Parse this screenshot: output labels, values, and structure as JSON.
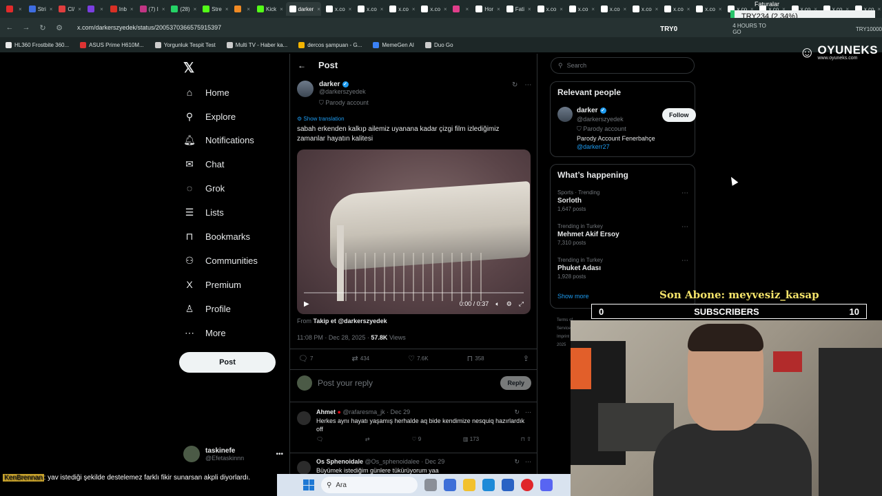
{
  "browser": {
    "tabs": [
      {
        "label": "",
        "color": "#e02b2b"
      },
      {
        "label": "Stri",
        "color": "#3e6de0"
      },
      {
        "label": "Cl/",
        "color": "#e03e3e"
      },
      {
        "label": "",
        "color": "#7a3ee0"
      },
      {
        "label": "Inb",
        "color": "#d93025"
      },
      {
        "label": "(7) I",
        "color": "#c13584"
      },
      {
        "label": "(28)",
        "color": "#25d366"
      },
      {
        "label": "Stre",
        "color": "#53fc18"
      },
      {
        "label": "",
        "color": "#f08a24"
      },
      {
        "label": "Kick",
        "color": "#53fc18"
      },
      {
        "label": "darker",
        "color": "#ffffff",
        "active": true
      },
      {
        "label": "x.co",
        "color": "#ffffff"
      },
      {
        "label": "x.co",
        "color": "#ffffff"
      },
      {
        "label": "x.co",
        "color": "#ffffff"
      },
      {
        "label": "x.co",
        "color": "#ffffff"
      },
      {
        "label": "",
        "color": "#e03e8a"
      },
      {
        "label": "Hor",
        "color": "#ffffff"
      },
      {
        "label": "Fati",
        "color": "#ffffff"
      },
      {
        "label": "x.co",
        "color": "#ffffff"
      },
      {
        "label": "x.co",
        "color": "#ffffff"
      },
      {
        "label": "x.co",
        "color": "#ffffff"
      },
      {
        "label": "x.co",
        "color": "#ffffff"
      },
      {
        "label": "x.co",
        "color": "#ffffff"
      },
      {
        "label": "x.co",
        "color": "#ffffff"
      },
      {
        "label": "x.co",
        "color": "#ffffff"
      },
      {
        "label": "x.co",
        "color": "#ffffff"
      },
      {
        "label": "x.co",
        "color": "#ffffff"
      },
      {
        "label": "x.co",
        "color": "#ffffff"
      },
      {
        "label": "x.co",
        "color": "#ffffff"
      }
    ],
    "url": "x.com/darkerszyedek/status/2005370366575915397",
    "bookmarks": [
      {
        "label": "HL360 Frostbite 360...",
        "color": "#e8e8e8"
      },
      {
        "label": "ASUS Prime H610M...",
        "color": "#d33"
      },
      {
        "label": "Yorgunluk Tespit Test",
        "color": "#ccc"
      },
      {
        "label": "Multi TV - Haber ka...",
        "color": "#ccc"
      },
      {
        "label": "dercos şampuan - G...",
        "color": "#f4b400"
      },
      {
        "label": "MemeGen AI",
        "color": "#3b82f6"
      },
      {
        "label": "Duo Go",
        "color": "#ccc"
      }
    ],
    "right_items": [
      "TRY0",
      "4 HOURS TO GO",
      "TRY10000"
    ]
  },
  "overlay": {
    "faturalar": "Faturalar",
    "ticker": "TRY234 (2.34%)",
    "brand": "OYUNEKS",
    "brand_url": "www.oyuneks.com",
    "son_abone": "Son Abone: meyvesiz_kasap",
    "sub_left": "0",
    "sub_label": "SUBSCRIBERS",
    "sub_right": "10",
    "chat_nick": "KenBrennan",
    "chat_text": ": yav istediği şekilde destelemez farklı fikir sunarsan akpli diyorlardı."
  },
  "nav": {
    "items": [
      {
        "label": "Home",
        "icon": "⌂"
      },
      {
        "label": "Explore",
        "icon": "⚲"
      },
      {
        "label": "Notifications",
        "icon": "🔔︎"
      },
      {
        "label": "Chat",
        "icon": "✉"
      },
      {
        "label": "Grok",
        "icon": "◌"
      },
      {
        "label": "Lists",
        "icon": "☰"
      },
      {
        "label": "Bookmarks",
        "icon": "⊓"
      },
      {
        "label": "Communities",
        "icon": "⚇"
      },
      {
        "label": "Premium",
        "icon": "X"
      },
      {
        "label": "Profile",
        "icon": "♙"
      },
      {
        "label": "More",
        "icon": "⋯"
      }
    ],
    "post_label": "Post",
    "account_name": "taskinefe",
    "account_handle": "@Efetaskinnn"
  },
  "post": {
    "header": "Post",
    "author": "darker",
    "handle": "@darkerszyedek",
    "parody": "Parody account",
    "show_translation": "Show translation",
    "text": "sabah erkenden kalkıp ailemiz uyanana kadar çizgi film izlediğimiz zamanlar hayatın kalitesi",
    "video_time": "0:00 / 0:37",
    "from_label": "From",
    "from_source": "Takip et @darkerszyedek",
    "timestamp": "11:08 PM · Dec 28, 2025 ·",
    "views_count": "57.8K",
    "views_label": "Views",
    "replies": "7",
    "reposts": "434",
    "likes": "7.6K",
    "bookmarks": "358",
    "reply_placeholder": "Post your reply",
    "reply_button": "Reply"
  },
  "replies": [
    {
      "name": "Ahmet",
      "handle": "@rafaresma_jk · Dec 29",
      "text": "Herkes aynı hayatı yaşamış herhalde aq bide kendimize nesquiq hazırlardık off",
      "likes": "9",
      "views": "173"
    },
    {
      "name": "Os Sphenoidale",
      "handle": "@Os_sphenoidalee · Dec 29",
      "text": "Büyümek istediğim günlere tükürüyorum yaa",
      "likes": "",
      "views": ""
    }
  ],
  "sidebar": {
    "search_placeholder": "Search",
    "relevant_title": "Relevant people",
    "person_name": "darker",
    "person_handle": "@darkerszyedek",
    "person_parody": "Parody account",
    "person_bio": "Parody Account Fenerbahçe",
    "person_link": "@darkerr27",
    "follow_label": "Follow",
    "happening_title": "What’s happening",
    "trends": [
      {
        "category": "Sports · Trending",
        "name": "Sorloth",
        "count": "1,647 posts"
      },
      {
        "category": "Trending in Turkey",
        "name": "Mehmet Akif Ersoy",
        "count": "7,310 posts"
      },
      {
        "category": "Trending in Turkey",
        "name": "Phuket Adası",
        "count": "1,928 posts"
      }
    ],
    "show_more": "Show more",
    "footer": "Terms of Service  Imprint  © 2025"
  },
  "taskbar": {
    "search_label": "Ara"
  }
}
